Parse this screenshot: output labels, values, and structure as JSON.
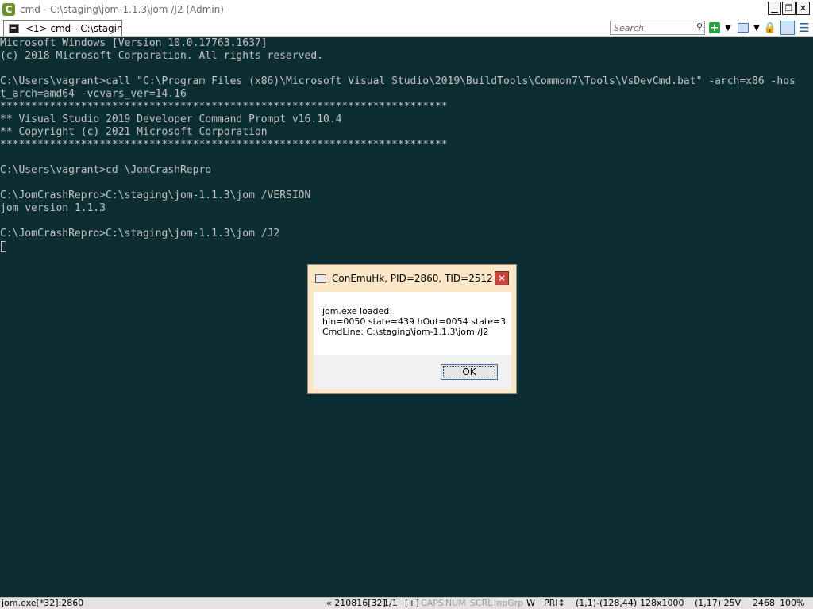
{
  "window": {
    "logo_glyph": "C",
    "title": "cmd - C:\\staging\\jom-1.1.3\\jom  /J2 (Admin)",
    "controls": {
      "minimize": "▁",
      "restore": "❐",
      "close": "✕"
    }
  },
  "tab": {
    "label": "<1> cmd - C:\\stagin..."
  },
  "toolbar": {
    "search_placeholder": "Search",
    "search_icon": "⚲",
    "new_console_icon": "+",
    "dropdown_glyph": "▼",
    "lock_icon": "🔒",
    "menu_icon": "☰"
  },
  "console": {
    "text": "Microsoft Windows [Version 10.0.17763.1637]\n(c) 2018 Microsoft Corporation. All rights reserved.\n\nC:\\Users\\vagrant>call \"C:\\Program Files (x86)\\Microsoft Visual Studio\\2019\\BuildTools\\Common7\\Tools\\VsDevCmd.bat\" -arch=x86 -hos\nt_arch=amd64 -vcvars_ver=14.16\n************************************************************************\n** Visual Studio 2019 Developer Command Prompt v16.10.4\n** Copyright (c) 2021 Microsoft Corporation\n************************************************************************\n\nC:\\Users\\vagrant>cd \\JomCrashRepro\n\nC:\\JomCrashRepro>C:\\staging\\jom-1.1.3\\jom /VERSION\njom version 1.1.3\n\nC:\\JomCrashRepro>C:\\staging\\jom-1.1.3\\jom /J2"
  },
  "dialog": {
    "title": "ConEmuHk, PID=2860, TID=2512",
    "close_glyph": "✕",
    "message_line1": "jom.exe loaded!",
    "message_line2": "hIn=0050 state=439 hOut=0054 state=3",
    "message_line3": "CmdLine: C:\\staging\\jom-1.1.3\\jom  /J2",
    "ok_label": "OK"
  },
  "statusbar": {
    "process": "jom.exe[*32]:2860",
    "build": "« 210816[32]",
    "pages": "1/1",
    "plus": "[+]",
    "caps": "CAPS",
    "num": "NUM",
    "scrl": "SCRL",
    "inpgrp": "InpGrp",
    "w": "W",
    "pri": "PRI↕",
    "selection": "(1,1)-(128,44)",
    "buffer": "128x1000",
    "cursor": "(1,17) 25V",
    "pid": "2468",
    "zoom": "100%"
  }
}
